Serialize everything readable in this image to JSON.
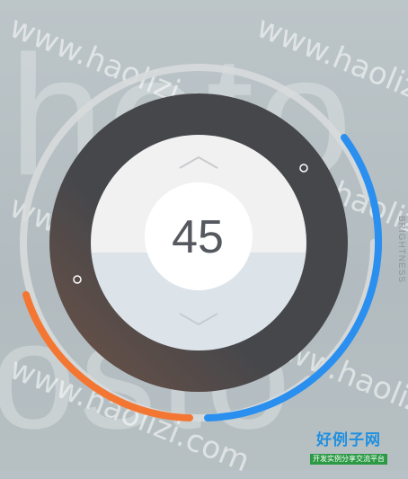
{
  "thermostat": {
    "value": "45",
    "side_label": "BRIGHTNESS"
  },
  "background": {
    "text_line1": "hoto",
    "text_line2": "osto"
  },
  "watermark": {
    "text": "www.haolizi.com"
  },
  "site_badge": {
    "title": "好例子网",
    "subtitle": "开发实例分享交流平台"
  },
  "colors": {
    "dial_ring": "#46474b",
    "inner_top": "#f1f1f2",
    "inner_bottom": "#dce4ea",
    "arc_blue": "#2a8fef",
    "arc_orange": "#f37733",
    "track": "#d8dadb"
  },
  "icons": {
    "up": "chevron-up-icon",
    "down": "chevron-down-icon"
  }
}
